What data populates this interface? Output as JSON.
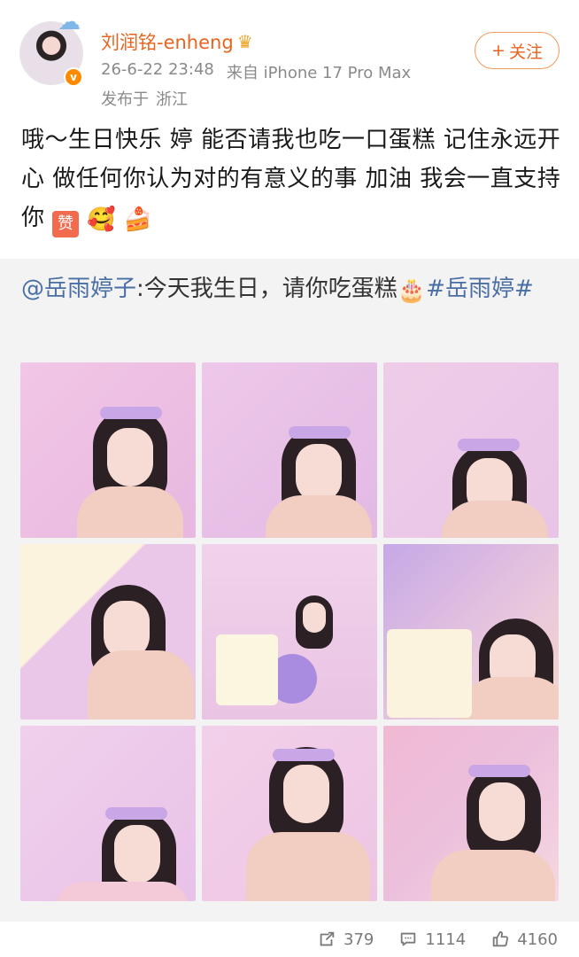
{
  "user": {
    "name": "刘润铭-enheng",
    "date": "26-6-22 23:48",
    "source": "来自 iPhone 17 Pro Max",
    "location_label": "发布于",
    "location": "浙江",
    "follow_label": "关注"
  },
  "post": {
    "text": "哦～生日快乐 婷 能否请我也吃一口蛋糕 记住永远开心 做任何你认为对的有意义的事 加油 我会一直支持你",
    "emoji_zan": "赞"
  },
  "repost": {
    "mention": "@岳雨婷子",
    "text": ":今天我生日，请你吃蛋糕",
    "hashtag": "#岳雨婷#"
  },
  "stats": {
    "reposts": "379",
    "comments": "1114",
    "likes": "4160"
  },
  "colors": {
    "username": "#e8641e",
    "link": "#4a6fa5",
    "repost_bg": "#f3f3f3"
  }
}
